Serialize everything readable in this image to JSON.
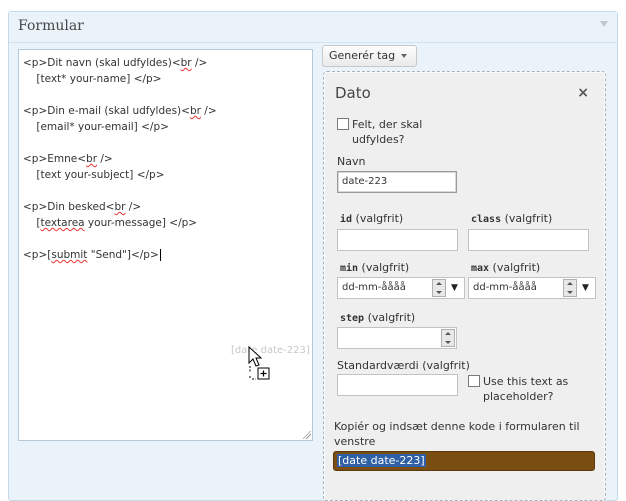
{
  "panel": {
    "title": "Formular"
  },
  "form_editor": {
    "lines": [
      "<p>Dit navn (skal udfyldes)<br />",
      "    [text* your-name] </p>",
      "",
      "<p>Din e-mail (skal udfyldes)<br />",
      "    [email* your-email] </p>",
      "",
      "<p>Emne<br />",
      "    [text your-subject] </p>",
      "",
      "<p>Din besked<br />",
      "    [textarea your-message] </p>",
      "",
      "<p>[submit \"Send\"]</p>"
    ],
    "drag_ghost_text": "[date date-223]"
  },
  "generate_button": {
    "label": "Generér tag"
  },
  "dialog": {
    "title": "Dato",
    "close_label": "×",
    "required_label": "Felt, der skal udfyldes?",
    "name_label": "Navn",
    "name_value": "date-223",
    "id_key": "id",
    "id_suffix": " (valgfrit)",
    "class_key": "class",
    "class_suffix": " (valgfrit)",
    "min_key": "min",
    "min_suffix": " (valgfrit)",
    "min_value": "dd-mm-åååå",
    "max_key": "max",
    "max_suffix": " (valgfrit)",
    "max_value": "dd-mm-åååå",
    "step_key": "step",
    "step_suffix": " (valgfrit)",
    "default_label": "Standardværdi (valgfrit)",
    "placeholder_label": "Use this text as placeholder?",
    "copy_instructions": "Kopiér og indsæt denne kode i formularen til venstre",
    "generated_code": "[date date-223]"
  },
  "icons": {
    "collapse": "triangle-down-icon",
    "close": "close-icon",
    "cursor": "move-copy-cursor-icon"
  },
  "colors": {
    "panel_bg": "#eaf2fa",
    "code_box_bg": "#7a4e10",
    "selection": "#2f5fa4"
  }
}
